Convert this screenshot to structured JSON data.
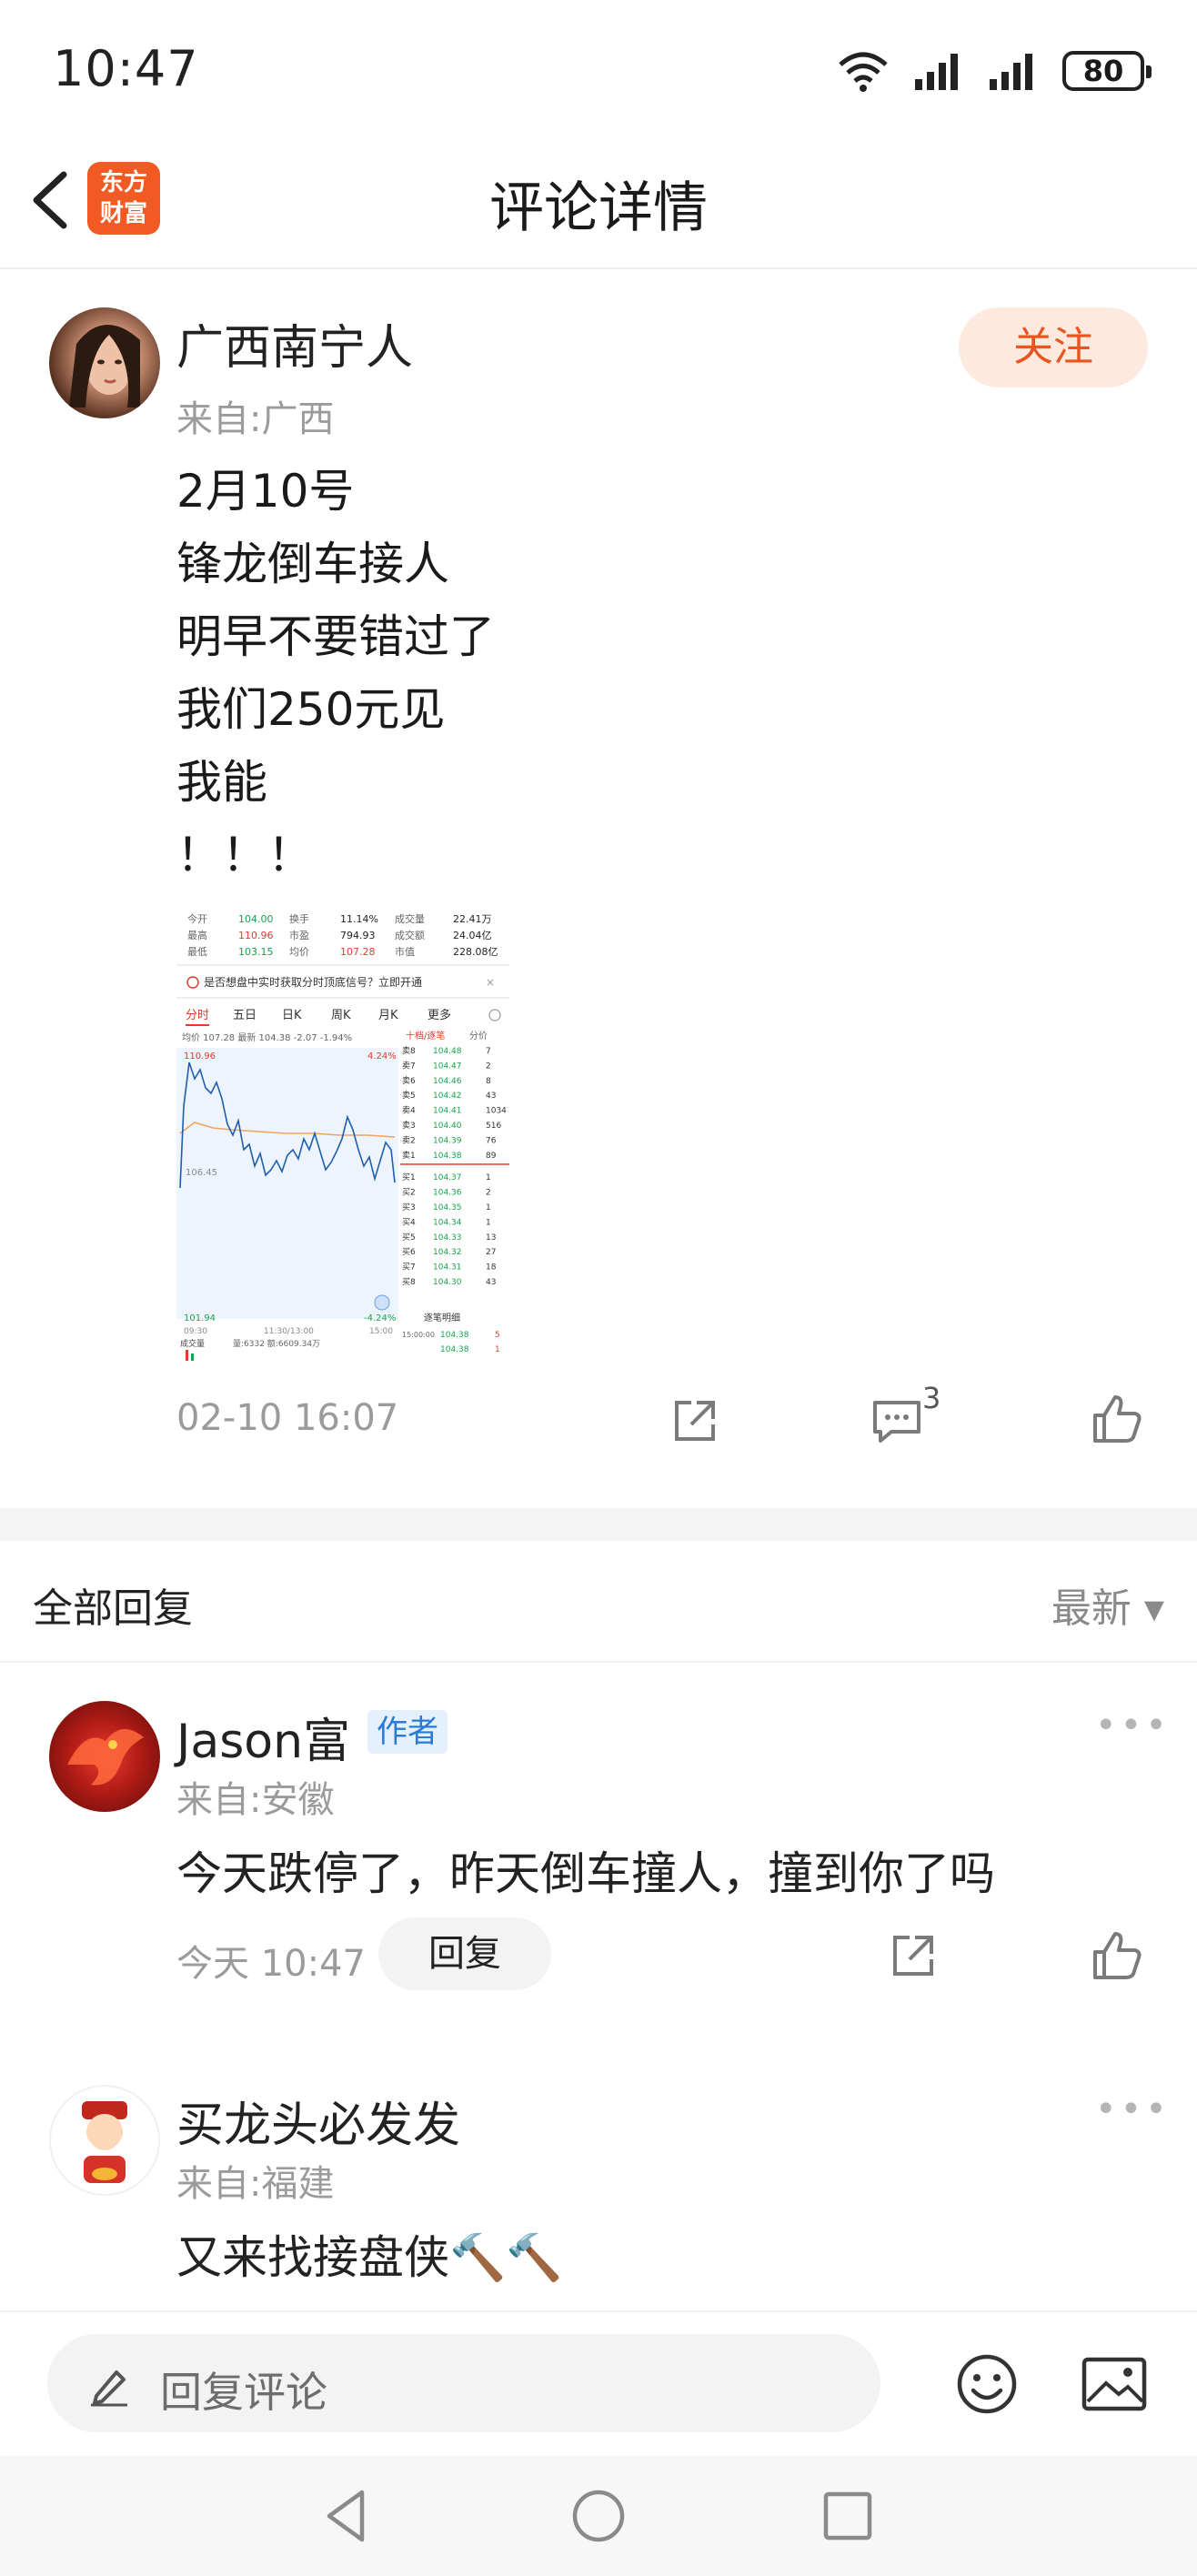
{
  "status": {
    "time": "10:47",
    "battery": "80"
  },
  "header": {
    "title": "评论详情",
    "logo_line1": "东方",
    "logo_line2": "财富"
  },
  "post": {
    "author": "广西南宁人",
    "from": "来自:广西",
    "follow_label": "关注",
    "lines": [
      "2月10号",
      "锋龙倒车接人",
      "明早不要错过了",
      "我们250元见",
      "我能",
      "！！！"
    ],
    "time": "02-10 16:07",
    "comment_count": "3",
    "stock": {
      "row1": [
        "今开",
        "104.00",
        "换手",
        "11.14%",
        "成交量",
        "22.41万"
      ],
      "row2": [
        "最高",
        "110.96",
        "市盈",
        "794.93",
        "成交额",
        "24.04亿"
      ],
      "row3": [
        "最低",
        "103.15",
        "均价",
        "107.28",
        "市值",
        "228.08亿"
      ],
      "banner": "是否想盘中实时获取分时顶底信号？立即开通",
      "tabs": [
        "分时",
        "五日",
        "日K",
        "周K",
        "月K",
        "更多"
      ],
      "avg_line": "均价 107.28 最新 104.38 -2.07 -1.94%",
      "high": "110.96",
      "low": "101.94",
      "high_pct": "4.24%",
      "low_pct": "-4.24%",
      "mid": "106.45",
      "time_left": "09:30",
      "time_mid": "11:30/13:00",
      "time_right": "15:00",
      "vol_label": "成交量",
      "vol_text": "量:6332 额:6609.34万",
      "side_tabs": [
        "十档/逐笔",
        "分价"
      ],
      "sells": [
        [
          "卖8",
          "104.48",
          "7"
        ],
        [
          "卖7",
          "104.47",
          "2"
        ],
        [
          "卖6",
          "104.46",
          "8"
        ],
        [
          "卖5",
          "104.42",
          "43"
        ],
        [
          "卖4",
          "104.41",
          "1034"
        ],
        [
          "卖3",
          "104.40",
          "516"
        ],
        [
          "卖2",
          "104.39",
          "76"
        ],
        [
          "卖1",
          "104.38",
          "89"
        ]
      ],
      "buys": [
        [
          "买1",
          "104.37",
          "1"
        ],
        [
          "买2",
          "104.36",
          "2"
        ],
        [
          "买3",
          "104.35",
          "1"
        ],
        [
          "买4",
          "104.34",
          "1"
        ],
        [
          "买5",
          "104.33",
          "13"
        ],
        [
          "买6",
          "104.32",
          "27"
        ],
        [
          "买7",
          "104.31",
          "18"
        ],
        [
          "买8",
          "104.30",
          "43"
        ]
      ],
      "detail_label": "逐笔明细",
      "tick1": [
        "15:00:00",
        "104.38",
        "5"
      ],
      "tick2": [
        "",
        "104.38",
        "1"
      ]
    }
  },
  "replies": {
    "section_title": "全部回复",
    "sort_label": "最新 ▾",
    "items": [
      {
        "author": "Jason富",
        "badge": "作者",
        "from": "来自:安徽",
        "text": "今天跌停了，昨天倒车撞人，撞到你了吗",
        "time": "今天 10:47",
        "reply_label": "回复"
      },
      {
        "author": "买龙头必发发",
        "from": "来自:福建",
        "text": "又来找接盘侠🔨🔨"
      }
    ]
  },
  "bottom": {
    "placeholder": "回复评论"
  }
}
